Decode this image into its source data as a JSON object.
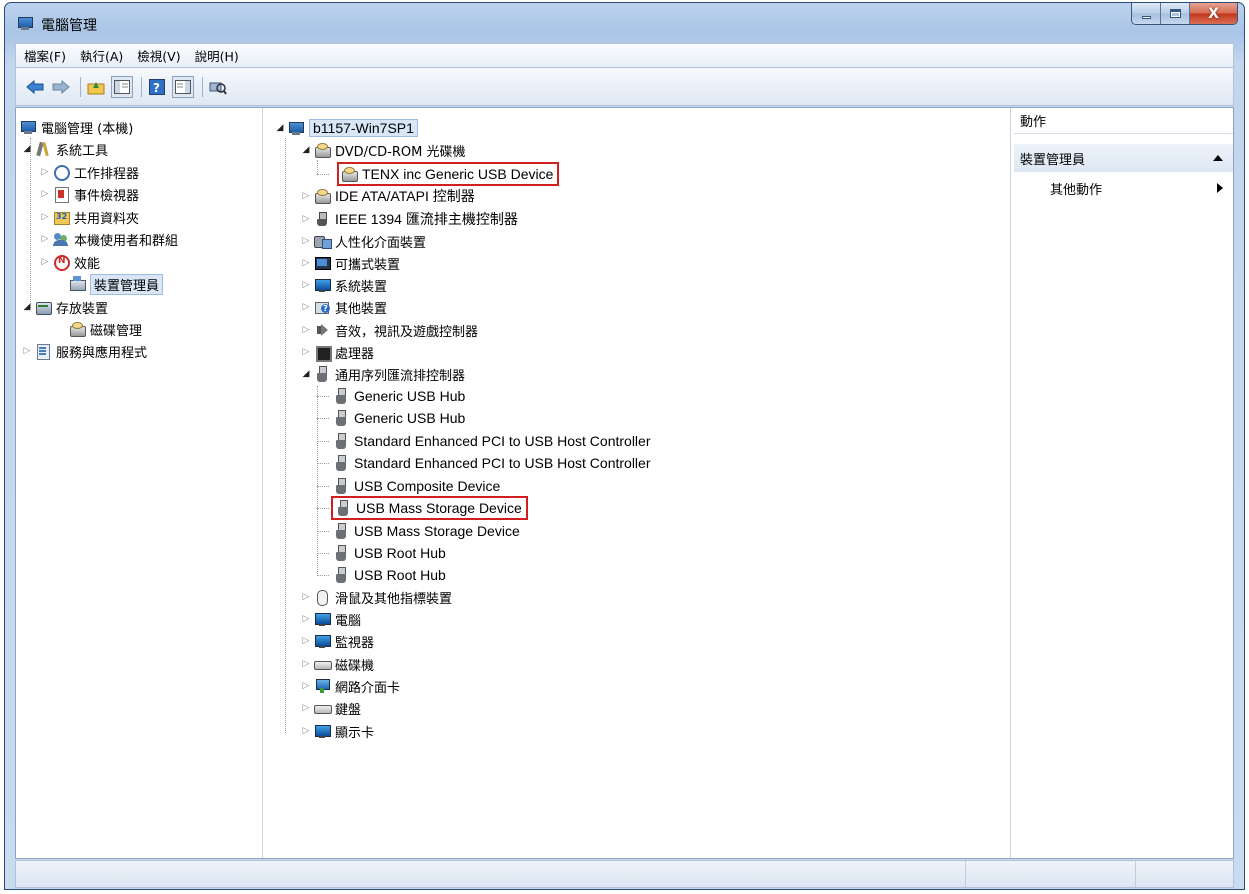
{
  "window": {
    "title": "電腦管理",
    "buttons": {
      "minimize": "minimize-icon",
      "maximize": "maximize-icon",
      "close": "X"
    }
  },
  "menu": [
    "檔案(F)",
    "執行(A)",
    "檢視(V)",
    "說明(H)"
  ],
  "toolbar": [
    "back-arrow-icon",
    "forward-arrow-icon",
    "up-folder-icon",
    "show-hide-tree-icon",
    "help-icon",
    "show-hide-action-pane-icon",
    "scan-hardware-icon"
  ],
  "left_tree": {
    "root": "電腦管理 (本機)",
    "system_tools": "系統工具",
    "task_scheduler": "工作排程器",
    "event_viewer": "事件檢視器",
    "shared_folders": "共用資料夾",
    "local_users": "本機使用者和群組",
    "performance": "效能",
    "device_manager": "裝置管理員",
    "storage": "存放裝置",
    "disk_management": "磁碟管理",
    "services": "服務與應用程式"
  },
  "device_tree": {
    "computer": "b1157-Win7SP1",
    "dvd": "DVD/CD-ROM 光碟機",
    "dvd_child": "TENX inc  Generic USB Device",
    "ide": "IDE ATA/ATAPI 控制器",
    "ieee": "IEEE 1394 匯流排主機控制器",
    "hid": "人性化介面裝置",
    "portable": "可攜式裝置",
    "system": "系統裝置",
    "other": "其他裝置",
    "sound": "音效，視訊及遊戲控制器",
    "processor": "處理器",
    "usb": "通用序列匯流排控制器",
    "usb_children": [
      "Generic USB Hub",
      "Generic USB Hub",
      "Standard Enhanced PCI to USB Host Controller",
      "Standard Enhanced PCI to USB Host Controller",
      "USB Composite Device",
      "USB Mass Storage Device",
      "USB Mass Storage Device",
      "USB Root Hub",
      "USB Root Hub"
    ],
    "mouse": "滑鼠及其他指標裝置",
    "computer_cat": "電腦",
    "monitor": "監視器",
    "disk": "磁碟機",
    "network": "網路介面卡",
    "keyboard": "鍵盤",
    "display": "顯示卡"
  },
  "actions": {
    "header": "動作",
    "group": "裝置管理員",
    "item": "其他動作"
  }
}
